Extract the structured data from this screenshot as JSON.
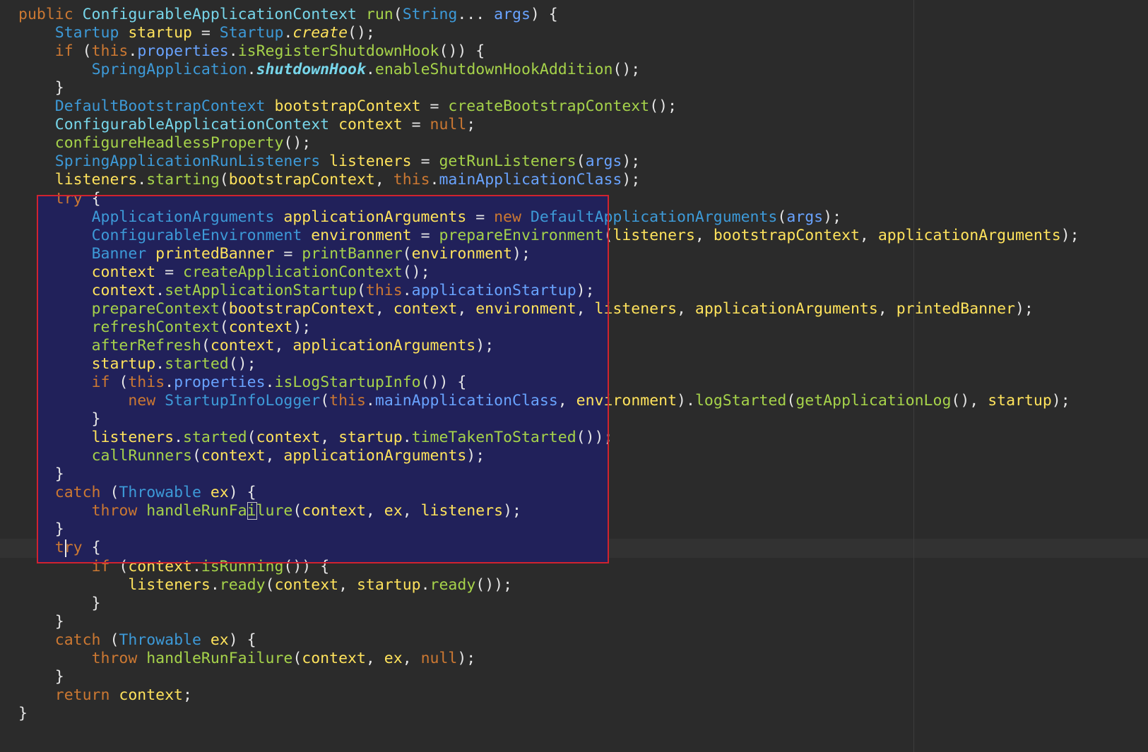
{
  "editor": {
    "colors": {
      "background": "#2b2b2b",
      "selection": "#21215a",
      "highlight_box": "#d0232f",
      "keyword": "#cc7832",
      "type": "#3d9ad8",
      "class_ref": "#77d6ea",
      "method": "#a6d34a",
      "variable": "#ffe35c",
      "field": "#69a3ff",
      "plain": "#e6e6e6"
    },
    "lines": [
      [
        [
          "public ",
          "kw"
        ],
        [
          "ConfigurableApplicationContext ",
          "cls"
        ],
        [
          "run",
          "fn"
        ],
        [
          "(",
          "p"
        ],
        [
          "String",
          "ty"
        ],
        [
          "... ",
          "p"
        ],
        [
          "args",
          "arg"
        ],
        [
          ") {",
          "p"
        ]
      ],
      [
        [
          "    ",
          "p"
        ],
        [
          "Startup ",
          "ty"
        ],
        [
          "startup ",
          "var"
        ],
        [
          "= ",
          "p"
        ],
        [
          "Startup",
          "ty"
        ],
        [
          ".",
          "p"
        ],
        [
          "create",
          "it"
        ],
        [
          "();",
          "p"
        ]
      ],
      [
        [
          "    ",
          "p"
        ],
        [
          "if ",
          "kw"
        ],
        [
          "(",
          "p"
        ],
        [
          "this",
          "kw"
        ],
        [
          ".",
          "p"
        ],
        [
          "properties",
          "fld"
        ],
        [
          ".",
          "p"
        ],
        [
          "isRegisterShutdownHook",
          "fn"
        ],
        [
          "()) {",
          "p"
        ]
      ],
      [
        [
          "        ",
          "p"
        ],
        [
          "SpringApplication",
          "ty"
        ],
        [
          ".",
          "p"
        ],
        [
          "shutdownHook",
          "bold"
        ],
        [
          ".",
          "p"
        ],
        [
          "enableShutdownHookAddition",
          "fn"
        ],
        [
          "();",
          "p"
        ]
      ],
      [
        [
          "    }",
          "p"
        ]
      ],
      [
        [
          "    ",
          "p"
        ],
        [
          "DefaultBootstrapContext ",
          "ty"
        ],
        [
          "bootstrapContext ",
          "var"
        ],
        [
          "= ",
          "p"
        ],
        [
          "createBootstrapContext",
          "fn"
        ],
        [
          "();",
          "p"
        ]
      ],
      [
        [
          "    ",
          "p"
        ],
        [
          "ConfigurableApplicationContext ",
          "cls"
        ],
        [
          "context ",
          "var"
        ],
        [
          "= ",
          "p"
        ],
        [
          "null",
          "kw"
        ],
        [
          ";",
          "p"
        ]
      ],
      [
        [
          "    ",
          "p"
        ],
        [
          "configureHeadlessProperty",
          "fn"
        ],
        [
          "();",
          "p"
        ]
      ],
      [
        [
          "    ",
          "p"
        ],
        [
          "SpringApplicationRunListeners ",
          "ty"
        ],
        [
          "listeners ",
          "var"
        ],
        [
          "= ",
          "p"
        ],
        [
          "getRunListeners",
          "fn"
        ],
        [
          "(",
          "p"
        ],
        [
          "args",
          "arg"
        ],
        [
          ");",
          "p"
        ]
      ],
      [
        [
          "    ",
          "p"
        ],
        [
          "listeners",
          "var"
        ],
        [
          ".",
          "p"
        ],
        [
          "starting",
          "fn"
        ],
        [
          "(",
          "p"
        ],
        [
          "bootstrapContext",
          "var"
        ],
        [
          ", ",
          "p"
        ],
        [
          "this",
          "kw"
        ],
        [
          ".",
          "p"
        ],
        [
          "mainApplicationClass",
          "fld"
        ],
        [
          ");",
          "p"
        ]
      ],
      [
        [
          "    ",
          "p"
        ],
        [
          "try ",
          "kw"
        ],
        [
          "{",
          "p"
        ]
      ],
      [
        [
          "        ",
          "p"
        ],
        [
          "ApplicationArguments ",
          "ty"
        ],
        [
          "applicationArguments ",
          "var"
        ],
        [
          "= ",
          "p"
        ],
        [
          "new ",
          "kw"
        ],
        [
          "DefaultApplicationArguments",
          "ty"
        ],
        [
          "(",
          "p"
        ],
        [
          "args",
          "arg"
        ],
        [
          ");",
          "p"
        ]
      ],
      [
        [
          "        ",
          "p"
        ],
        [
          "ConfigurableEnvironment ",
          "ty"
        ],
        [
          "environment ",
          "var"
        ],
        [
          "= ",
          "p"
        ],
        [
          "prepareEnvironment",
          "fn"
        ],
        [
          "(",
          "p"
        ],
        [
          "listeners",
          "var"
        ],
        [
          ", ",
          "p"
        ],
        [
          "bootstrapContext",
          "var"
        ],
        [
          ", ",
          "p"
        ],
        [
          "applicationArguments",
          "var"
        ],
        [
          ");",
          "p"
        ]
      ],
      [
        [
          "        ",
          "p"
        ],
        [
          "Banner ",
          "ty"
        ],
        [
          "printedBanner ",
          "var"
        ],
        [
          "= ",
          "p"
        ],
        [
          "printBanner",
          "fn"
        ],
        [
          "(",
          "p"
        ],
        [
          "environment",
          "var"
        ],
        [
          ");",
          "p"
        ]
      ],
      [
        [
          "        ",
          "p"
        ],
        [
          "context ",
          "var"
        ],
        [
          "= ",
          "p"
        ],
        [
          "createApplicationContext",
          "fn"
        ],
        [
          "();",
          "p"
        ]
      ],
      [
        [
          "        ",
          "p"
        ],
        [
          "context",
          "var"
        ],
        [
          ".",
          "p"
        ],
        [
          "setApplicationStartup",
          "fn"
        ],
        [
          "(",
          "p"
        ],
        [
          "this",
          "kw"
        ],
        [
          ".",
          "p"
        ],
        [
          "applicationStartup",
          "fld"
        ],
        [
          ");",
          "p"
        ]
      ],
      [
        [
          "        ",
          "p"
        ],
        [
          "prepareContext",
          "fn"
        ],
        [
          "(",
          "p"
        ],
        [
          "bootstrapContext",
          "var"
        ],
        [
          ", ",
          "p"
        ],
        [
          "context",
          "var"
        ],
        [
          ", ",
          "p"
        ],
        [
          "environment",
          "var"
        ],
        [
          ", ",
          "p"
        ],
        [
          "listeners",
          "var"
        ],
        [
          ", ",
          "p"
        ],
        [
          "applicationArguments",
          "var"
        ],
        [
          ", ",
          "p"
        ],
        [
          "printedBanner",
          "var"
        ],
        [
          ");",
          "p"
        ]
      ],
      [
        [
          "        ",
          "p"
        ],
        [
          "refreshContext",
          "fn"
        ],
        [
          "(",
          "p"
        ],
        [
          "context",
          "var"
        ],
        [
          ");",
          "p"
        ]
      ],
      [
        [
          "        ",
          "p"
        ],
        [
          "afterRefresh",
          "fn"
        ],
        [
          "(",
          "p"
        ],
        [
          "context",
          "var"
        ],
        [
          ", ",
          "p"
        ],
        [
          "applicationArguments",
          "var"
        ],
        [
          ");",
          "p"
        ]
      ],
      [
        [
          "        ",
          "p"
        ],
        [
          "startup",
          "var"
        ],
        [
          ".",
          "p"
        ],
        [
          "started",
          "fn"
        ],
        [
          "();",
          "p"
        ]
      ],
      [
        [
          "        ",
          "p"
        ],
        [
          "if ",
          "kw"
        ],
        [
          "(",
          "p"
        ],
        [
          "this",
          "kw"
        ],
        [
          ".",
          "p"
        ],
        [
          "properties",
          "fld"
        ],
        [
          ".",
          "p"
        ],
        [
          "isLogStartupInfo",
          "fn"
        ],
        [
          "()) {",
          "p"
        ]
      ],
      [
        [
          "            ",
          "p"
        ],
        [
          "new ",
          "kw"
        ],
        [
          "StartupInfoLogger",
          "ty"
        ],
        [
          "(",
          "p"
        ],
        [
          "this",
          "kw"
        ],
        [
          ".",
          "p"
        ],
        [
          "mainApplicationClass",
          "fld"
        ],
        [
          ", ",
          "p"
        ],
        [
          "environment",
          "var"
        ],
        [
          ").",
          "p"
        ],
        [
          "logStarted",
          "fn"
        ],
        [
          "(",
          "p"
        ],
        [
          "getApplicationLog",
          "fn"
        ],
        [
          "(), ",
          "p"
        ],
        [
          "startup",
          "var"
        ],
        [
          ");",
          "p"
        ]
      ],
      [
        [
          "        }",
          "p"
        ]
      ],
      [
        [
          "        ",
          "p"
        ],
        [
          "listeners",
          "var"
        ],
        [
          ".",
          "p"
        ],
        [
          "started",
          "fn"
        ],
        [
          "(",
          "p"
        ],
        [
          "context",
          "var"
        ],
        [
          ", ",
          "p"
        ],
        [
          "startup",
          "var"
        ],
        [
          ".",
          "p"
        ],
        [
          "timeTakenToStarted",
          "fn"
        ],
        [
          "());",
          "p"
        ]
      ],
      [
        [
          "        ",
          "p"
        ],
        [
          "callRunners",
          "fn"
        ],
        [
          "(",
          "p"
        ],
        [
          "context",
          "var"
        ],
        [
          ", ",
          "p"
        ],
        [
          "applicationArguments",
          "var"
        ],
        [
          ");",
          "p"
        ]
      ],
      [
        [
          "    }",
          "p"
        ]
      ],
      [
        [
          "    ",
          "p"
        ],
        [
          "catch ",
          "kw"
        ],
        [
          "(",
          "p"
        ],
        [
          "Throwable ",
          "ty"
        ],
        [
          "ex",
          "var"
        ],
        [
          ") ",
          "p"
        ],
        [
          "{",
          "p"
        ]
      ],
      [
        [
          "        ",
          "p"
        ],
        [
          "throw ",
          "kw"
        ],
        [
          "handleRunFailure",
          "fn"
        ],
        [
          "(",
          "p"
        ],
        [
          "context",
          "var"
        ],
        [
          ", ",
          "p"
        ],
        [
          "ex",
          "var"
        ],
        [
          ", ",
          "p"
        ],
        [
          "listeners",
          "var"
        ],
        [
          ");",
          "p"
        ]
      ],
      [
        [
          "    }",
          "p"
        ]
      ],
      [
        [
          "    ",
          "p"
        ],
        [
          "try ",
          "kw"
        ],
        [
          "{",
          "p"
        ]
      ],
      [
        [
          "        ",
          "p"
        ],
        [
          "if ",
          "kw"
        ],
        [
          "(",
          "p"
        ],
        [
          "context",
          "var"
        ],
        [
          ".",
          "p"
        ],
        [
          "isRunning",
          "fn"
        ],
        [
          "()) {",
          "p"
        ]
      ],
      [
        [
          "            ",
          "p"
        ],
        [
          "listeners",
          "var"
        ],
        [
          ".",
          "p"
        ],
        [
          "ready",
          "fn"
        ],
        [
          "(",
          "p"
        ],
        [
          "context",
          "var"
        ],
        [
          ", ",
          "p"
        ],
        [
          "startup",
          "var"
        ],
        [
          ".",
          "p"
        ],
        [
          "ready",
          "fn"
        ],
        [
          "());",
          "p"
        ]
      ],
      [
        [
          "        }",
          "p"
        ]
      ],
      [
        [
          "    }",
          "p"
        ]
      ],
      [
        [
          "    ",
          "p"
        ],
        [
          "catch ",
          "kw"
        ],
        [
          "(",
          "p"
        ],
        [
          "Throwable ",
          "ty"
        ],
        [
          "ex",
          "var"
        ],
        [
          ") {",
          "p"
        ]
      ],
      [
        [
          "        ",
          "p"
        ],
        [
          "throw ",
          "kw"
        ],
        [
          "handleRunFailure",
          "fn"
        ],
        [
          "(",
          "p"
        ],
        [
          "context",
          "var"
        ],
        [
          ", ",
          "p"
        ],
        [
          "ex",
          "var"
        ],
        [
          ", ",
          "p"
        ],
        [
          "null",
          "kw"
        ],
        [
          ");",
          "p"
        ]
      ],
      [
        [
          "    }",
          "p"
        ]
      ],
      [
        [
          "    ",
          "p"
        ],
        [
          "return ",
          "kw"
        ],
        [
          "context",
          "var"
        ],
        [
          ";",
          "p"
        ]
      ],
      [
        [
          "}",
          "p"
        ]
      ]
    ]
  }
}
